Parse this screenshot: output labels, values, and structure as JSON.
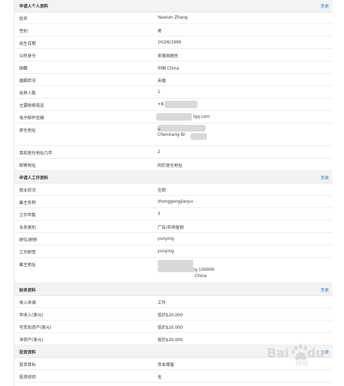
{
  "sections": {
    "personal": {
      "title": "申请人个人资料",
      "edit": "变更"
    },
    "work": {
      "title": "申请人工作资料",
      "edit": "变更"
    },
    "finance": {
      "title": "财务资料",
      "edit": "变更"
    },
    "invest": {
      "title": "投资资料",
      "edit": "变更"
    }
  },
  "personal_rows": [
    {
      "label": "姓名",
      "value": "Yaoxian Zhang"
    },
    {
      "label": "性别",
      "value": "男"
    },
    {
      "label": "出生日期",
      "value": "10/26/1990"
    },
    {
      "label": "公民身分",
      "value": "非美国居民"
    },
    {
      "label": "国籍",
      "value": "中国 China"
    },
    {
      "label": "婚姻状况",
      "value": "未婚"
    },
    {
      "label": "抚养人数",
      "value": "1"
    },
    {
      "label": "主要联络电话",
      "value": "+8"
    },
    {
      "label": "电子邮件信箱",
      "value": "lqq.com"
    },
    {
      "label": "居住地址",
      "value": "u\nChenxiang Br"
    },
    {
      "label": "目前居住地址几年",
      "value": "2"
    },
    {
      "label": "邮寄地址",
      "value": "同於居住地址"
    }
  ],
  "work_rows": [
    {
      "label": "就业状况",
      "value": "在职"
    },
    {
      "label": "雇主名称",
      "value": "zhonggongjiaoyu"
    },
    {
      "label": "工作年数",
      "value": "3"
    },
    {
      "label": "业务类别",
      "value": "广告/市场营销"
    },
    {
      "label": "职位/职称",
      "value": "yunying"
    },
    {
      "label": "工作职责",
      "value": "yunying"
    },
    {
      "label": "雇主地址",
      "value": "g 100000\nChina"
    }
  ],
  "finance_rows": [
    {
      "label": "收入来源",
      "value": "工作"
    },
    {
      "label": "年收入(美元)",
      "value": "低於$20,000"
    },
    {
      "label": "可变现资产(美元)",
      "value": "低於$20,000"
    },
    {
      "label": "净资产(美元)",
      "value": "低於$20,000"
    }
  ],
  "invest_rows": [
    {
      "label": "投资目标",
      "value": "资本增值"
    },
    {
      "label": "投资经验",
      "value": "无"
    }
  ],
  "watermark": "Baidu经验"
}
